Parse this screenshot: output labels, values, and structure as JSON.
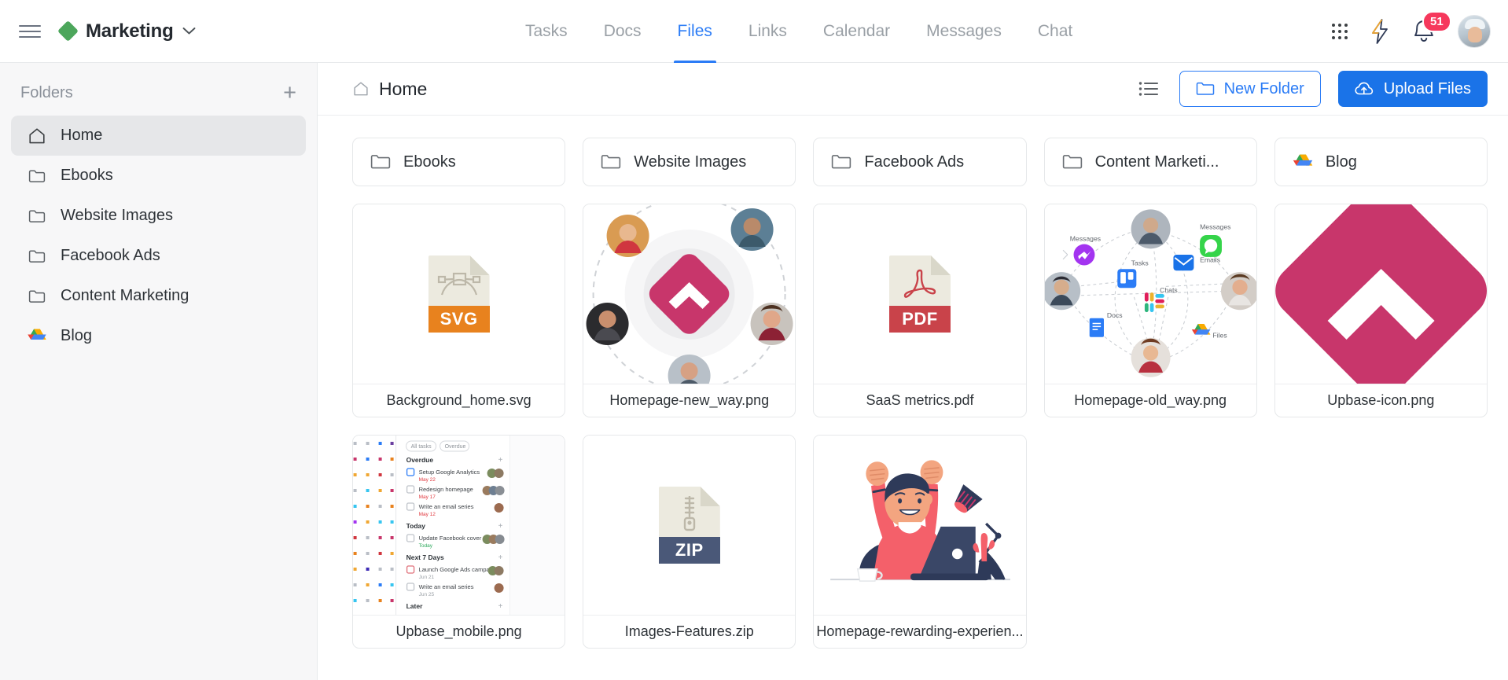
{
  "topbar": {
    "menu_icon": "hamburger-menu-icon",
    "workspace": {
      "name": "Marketing",
      "color": "#4CA65B",
      "caret": "⌄"
    },
    "tabs": [
      {
        "label": "Tasks",
        "active": false
      },
      {
        "label": "Docs",
        "active": false
      },
      {
        "label": "Files",
        "active": true
      },
      {
        "label": "Links",
        "active": false
      },
      {
        "label": "Calendar",
        "active": false
      },
      {
        "label": "Messages",
        "active": false
      },
      {
        "label": "Chat",
        "active": false
      }
    ],
    "active_tab_color": "#2b7cf6",
    "apps_icon": "apps-grid-icon",
    "bolt_icon": "lightning-bolt-icon",
    "bell_icon": "notification-bell-icon",
    "notification_count": "51",
    "notification_badge_color": "#f6385c",
    "avatar": "user-avatar"
  },
  "sidebar": {
    "title": "Folders",
    "add_label": "+",
    "items": [
      {
        "label": "Home",
        "icon": "home-icon",
        "active": true
      },
      {
        "label": "Ebooks",
        "icon": "folder-icon",
        "active": false
      },
      {
        "label": "Website Images",
        "icon": "folder-icon",
        "active": false
      },
      {
        "label": "Facebook Ads",
        "icon": "folder-icon",
        "active": false
      },
      {
        "label": "Content Marketing",
        "icon": "folder-icon",
        "active": false
      },
      {
        "label": "Blog",
        "icon": "google-drive-icon",
        "active": false
      }
    ]
  },
  "content": {
    "breadcrumb": {
      "label": "Home",
      "icon": "home-icon"
    },
    "toolbar": {
      "list_view_icon": "list-view-icon",
      "new_folder_label": "New Folder",
      "upload_files_label": "Upload Files",
      "primary_color": "#1a73e8"
    },
    "folders": [
      {
        "label": "Ebooks",
        "icon": "folder-icon"
      },
      {
        "label": "Website Images",
        "icon": "folder-icon"
      },
      {
        "label": "Facebook Ads",
        "icon": "folder-icon"
      },
      {
        "label": "Content Marketi...",
        "icon": "folder-icon"
      },
      {
        "label": "Blog",
        "icon": "google-drive-icon"
      }
    ],
    "files_row1": [
      {
        "label": "Background_home.svg",
        "thumb": "svg-file-icon",
        "ext": "SVG",
        "band_color": "#e8821e"
      },
      {
        "label": "Homepage-new_way.png",
        "thumb": "avatars-circle-image"
      },
      {
        "label": "SaaS metrics.pdf",
        "thumb": "pdf-file-icon",
        "ext": "PDF",
        "band_color": "#c9434a"
      },
      {
        "label": "Homepage-old_way.png",
        "thumb": "network-diagram-image"
      },
      {
        "label": "Upbase-icon.png",
        "thumb": "upbase-logo-image"
      }
    ],
    "files_row2": [
      {
        "label": "Upbase_mobile.png",
        "thumb": "mobile-app-screenshot"
      },
      {
        "label": "Images-Features.zip",
        "thumb": "zip-file-icon",
        "ext": "ZIP",
        "band_color": "#4a5878"
      },
      {
        "label": "Homepage-rewarding-experien...",
        "thumb": "celebrating-person-illustration"
      }
    ],
    "thumb_details": {
      "network_diagram_labels": [
        "Messages",
        "Messages",
        "Emails",
        "Tasks",
        "Chats",
        "Docs",
        "Files"
      ],
      "mobile_screenshot_sections": [
        "Overdue",
        "Today",
        "Next 7 Days",
        "Later"
      ],
      "mobile_screenshot_chips": [
        "All tasks",
        "Overdue"
      ],
      "mobile_screenshot_tasks": [
        {
          "title": "Setup Google Analytics",
          "due": "May 22"
        },
        {
          "title": "Redesign homepage",
          "due": "May 17"
        },
        {
          "title": "Write an email series",
          "due": "May 12"
        },
        {
          "title": "Update Facebook cover",
          "due": "Today"
        },
        {
          "title": "Launch Google Ads campaign",
          "due": "Jun 21"
        },
        {
          "title": "Write an email series",
          "due": "Jun 25"
        }
      ]
    },
    "brand_colors": {
      "upbase_pink": "#c8366b",
      "accent_blue": "#2b7cf6"
    }
  }
}
